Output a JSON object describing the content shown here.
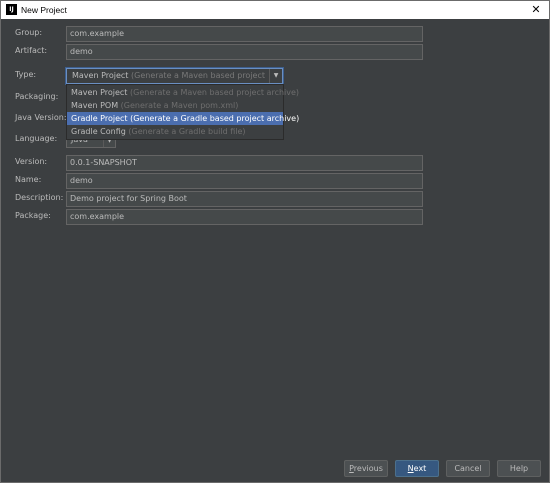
{
  "window": {
    "title": "New Project",
    "app_icon_text": "IJ"
  },
  "form": {
    "group": {
      "label": "Group:",
      "value": "com.example"
    },
    "artifact": {
      "label": "Artifact:",
      "value": "demo"
    },
    "type": {
      "label": "Type:",
      "selected_main": "Maven Project",
      "selected_hint": "(Generate a Maven based project archive)",
      "options": [
        {
          "main": "Maven Project",
          "hint": "(Generate a Maven based project archive)"
        },
        {
          "main": "Maven POM",
          "hint": "(Generate a Maven pom.xml)"
        },
        {
          "main": "Gradle Project",
          "hint": "(Generate a Gradle based project archive)"
        },
        {
          "main": "Gradle Config",
          "hint": "(Generate a Gradle build file)"
        }
      ]
    },
    "packaging": {
      "label": "Packaging:"
    },
    "java_version": {
      "label": "Java Version:"
    },
    "language": {
      "label": "Language:",
      "value": "Java"
    },
    "version": {
      "label": "Version:",
      "value": "0.0.1-SNAPSHOT"
    },
    "name": {
      "label": "Name:",
      "value": "demo"
    },
    "description": {
      "label": "Description:",
      "value": "Demo project for Spring Boot"
    },
    "package": {
      "label": "Package:",
      "value": "com.example"
    }
  },
  "buttons": {
    "previous_first": "P",
    "previous_rest": "revious",
    "next_first": "N",
    "next_rest": "ext",
    "cancel": "Cancel",
    "help": "Help"
  }
}
